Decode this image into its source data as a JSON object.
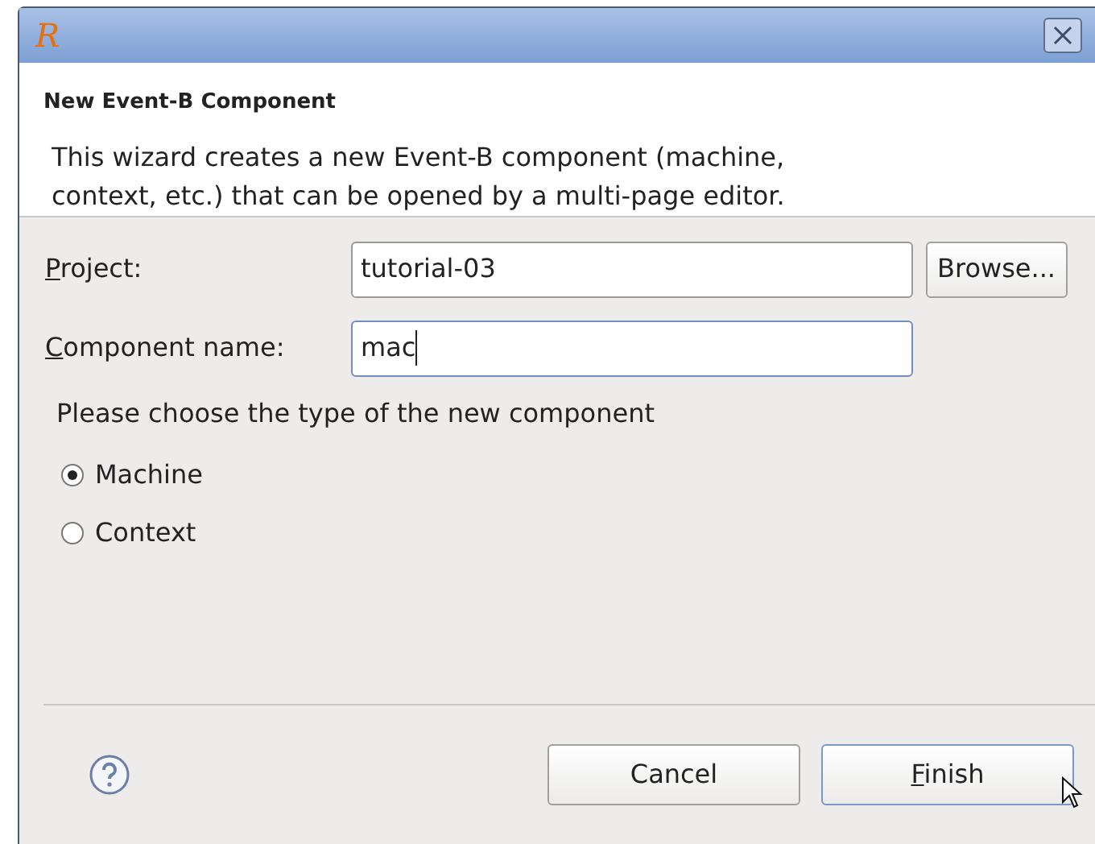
{
  "window": {
    "title_icon": "R"
  },
  "header": {
    "title": "New Event-B Component",
    "description": "This wizard creates a new Event-B component (machine, context, etc.) that can be opened by a multi-page editor."
  },
  "fields": [
    {
      "label": "Project:",
      "value": "tutorial-03",
      "focused": false,
      "button": "Browse..."
    },
    {
      "label": "Component name:",
      "value": "mac",
      "focused": true
    }
  ],
  "type_group": {
    "label": "Please choose the type of the new component",
    "options": [
      {
        "label": "Machine",
        "selected": true
      },
      {
        "label": "Context",
        "selected": false
      }
    ]
  },
  "buttons": [
    {
      "label": "Cancel",
      "default": false
    },
    {
      "label": "Finish",
      "default": true
    }
  ]
}
